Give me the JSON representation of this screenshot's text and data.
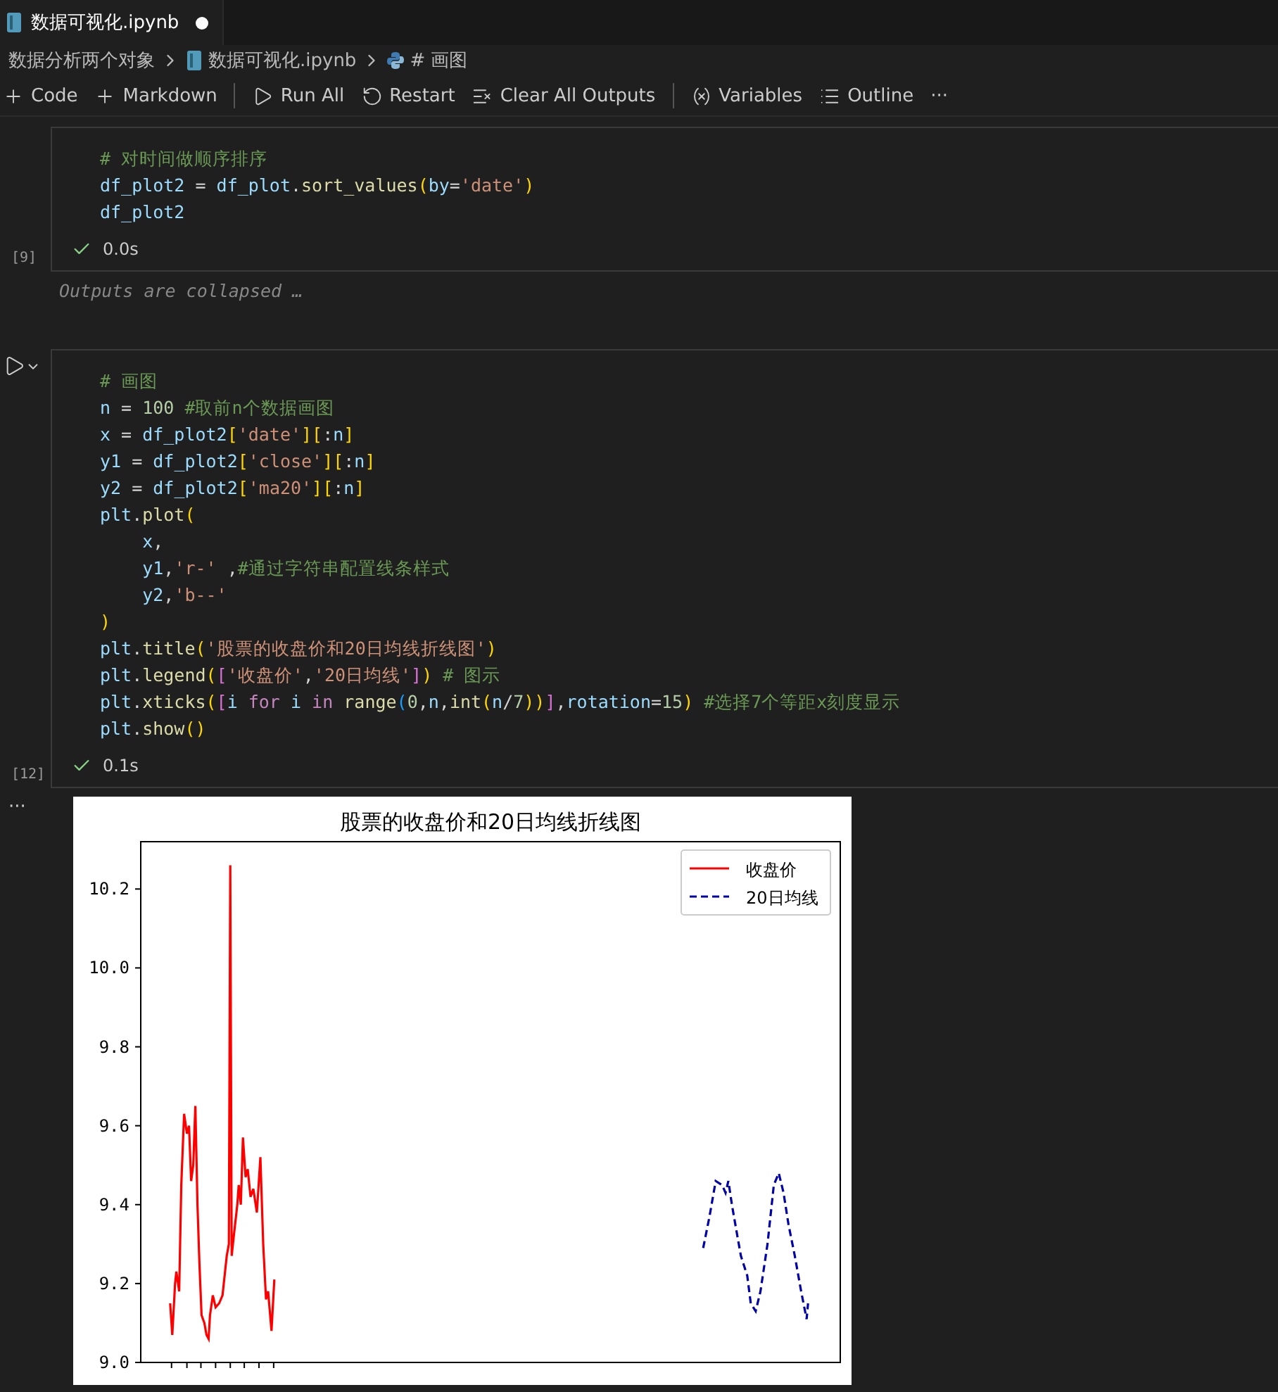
{
  "tab": {
    "title": "数据可视化.ipynb",
    "modified": true
  },
  "breadcrumb": [
    "数据分析两个对象",
    "数据可视化.ipynb",
    "# 画图"
  ],
  "toolbar": [
    {
      "kind": "plus",
      "label": "Code"
    },
    {
      "kind": "plus",
      "label": "Markdown"
    },
    {
      "kind": "separator"
    },
    {
      "kind": "run",
      "label": "Run All"
    },
    {
      "kind": "restart",
      "label": "Restart"
    },
    {
      "kind": "clear",
      "label": "Clear All Outputs"
    },
    {
      "kind": "separator"
    },
    {
      "kind": "variables",
      "label": "Variables"
    },
    {
      "kind": "outline",
      "label": "Outline"
    },
    {
      "kind": "more",
      "label": "···"
    }
  ],
  "cells": [
    {
      "count": "[9]",
      "time": "0.0s",
      "run_button": false,
      "collapsed_note": "Outputs are collapsed …",
      "lines": [
        [
          {
            "text": "# 对时间做顺序排序",
            "kind": "comment"
          }
        ],
        [
          {
            "text": "df_plot2",
            "kind": "var"
          },
          {
            "text": " = ",
            "kind": "plain"
          },
          {
            "text": "df_plot",
            "kind": "var"
          },
          {
            "text": ".",
            "kind": "plain"
          },
          {
            "text": "sort_values",
            "kind": "func"
          },
          {
            "text": "(",
            "kind": "paren"
          },
          {
            "text": "by",
            "kind": "var"
          },
          {
            "text": "=",
            "kind": "plain"
          },
          {
            "text": "'date'",
            "kind": "string"
          },
          {
            "text": ")",
            "kind": "paren"
          }
        ],
        [
          {
            "text": "df_plot2",
            "kind": "var"
          }
        ]
      ]
    },
    {
      "count": "[12]",
      "time": "0.1s",
      "run_button": true,
      "output_marker": "···",
      "lines": [
        [
          {
            "text": "# 画图",
            "kind": "comment"
          }
        ],
        [
          {
            "text": "n",
            "kind": "var"
          },
          {
            "text": " = ",
            "kind": "plain"
          },
          {
            "text": "100",
            "kind": "number"
          },
          {
            "text": " #取前n个数据画图",
            "kind": "comment"
          }
        ],
        [
          {
            "text": "x",
            "kind": "var"
          },
          {
            "text": " = ",
            "kind": "plain"
          },
          {
            "text": "df_plot2",
            "kind": "var"
          },
          {
            "text": "[",
            "kind": "paren"
          },
          {
            "text": "'date'",
            "kind": "string"
          },
          {
            "text": "][",
            "kind": "paren"
          },
          {
            "text": ":",
            "kind": "plain"
          },
          {
            "text": "n",
            "kind": "var"
          },
          {
            "text": "]",
            "kind": "paren"
          }
        ],
        [
          {
            "text": "y1",
            "kind": "var"
          },
          {
            "text": " = ",
            "kind": "plain"
          },
          {
            "text": "df_plot2",
            "kind": "var"
          },
          {
            "text": "[",
            "kind": "paren"
          },
          {
            "text": "'close'",
            "kind": "string"
          },
          {
            "text": "][",
            "kind": "paren"
          },
          {
            "text": ":",
            "kind": "plain"
          },
          {
            "text": "n",
            "kind": "var"
          },
          {
            "text": "]",
            "kind": "paren"
          }
        ],
        [
          {
            "text": "y2",
            "kind": "var"
          },
          {
            "text": " = ",
            "kind": "plain"
          },
          {
            "text": "df_plot2",
            "kind": "var"
          },
          {
            "text": "[",
            "kind": "paren"
          },
          {
            "text": "'ma20'",
            "kind": "string"
          },
          {
            "text": "][",
            "kind": "paren"
          },
          {
            "text": ":",
            "kind": "plain"
          },
          {
            "text": "n",
            "kind": "var"
          },
          {
            "text": "]",
            "kind": "paren"
          }
        ],
        [
          {
            "text": "plt",
            "kind": "var"
          },
          {
            "text": ".",
            "kind": "plain"
          },
          {
            "text": "plot",
            "kind": "func"
          },
          {
            "text": "(",
            "kind": "paren"
          }
        ],
        [
          {
            "text": "    x",
            "kind": "var"
          },
          {
            "text": ",",
            "kind": "plain"
          }
        ],
        [
          {
            "text": "    y1",
            "kind": "var"
          },
          {
            "text": ",",
            "kind": "plain"
          },
          {
            "text": "'r-'",
            "kind": "string"
          },
          {
            "text": " ,",
            "kind": "plain"
          },
          {
            "text": "#通过字符串配置线条样式",
            "kind": "comment"
          }
        ],
        [
          {
            "text": "    y2",
            "kind": "var"
          },
          {
            "text": ",",
            "kind": "plain"
          },
          {
            "text": "'b--'",
            "kind": "string"
          }
        ],
        [
          {
            "text": ")",
            "kind": "paren"
          }
        ],
        [
          {
            "text": "plt",
            "kind": "var"
          },
          {
            "text": ".",
            "kind": "plain"
          },
          {
            "text": "title",
            "kind": "func"
          },
          {
            "text": "(",
            "kind": "paren"
          },
          {
            "text": "'股票的收盘价和20日均线折线图'",
            "kind": "string"
          },
          {
            "text": ")",
            "kind": "paren"
          }
        ],
        [
          {
            "text": "plt",
            "kind": "var"
          },
          {
            "text": ".",
            "kind": "plain"
          },
          {
            "text": "legend",
            "kind": "func"
          },
          {
            "text": "(",
            "kind": "paren"
          },
          {
            "text": "[",
            "kind": "bracket"
          },
          {
            "text": "'收盘价'",
            "kind": "string"
          },
          {
            "text": ",",
            "kind": "plain"
          },
          {
            "text": "'20日均线'",
            "kind": "string"
          },
          {
            "text": "]",
            "kind": "bracket"
          },
          {
            "text": ")",
            "kind": "paren"
          },
          {
            "text": " # 图示",
            "kind": "comment"
          }
        ],
        [
          {
            "text": "plt",
            "kind": "var"
          },
          {
            "text": ".",
            "kind": "plain"
          },
          {
            "text": "xticks",
            "kind": "func"
          },
          {
            "text": "(",
            "kind": "paren"
          },
          {
            "text": "[",
            "kind": "bracket"
          },
          {
            "text": "i",
            "kind": "var"
          },
          {
            "text": " for ",
            "kind": "keyword"
          },
          {
            "text": "i",
            "kind": "var"
          },
          {
            "text": " in ",
            "kind": "keyword"
          },
          {
            "text": "range",
            "kind": "func"
          },
          {
            "text": "(",
            "kind": "paren3"
          },
          {
            "text": "0",
            "kind": "number"
          },
          {
            "text": ",",
            "kind": "plain"
          },
          {
            "text": "n",
            "kind": "var"
          },
          {
            "text": ",",
            "kind": "plain"
          },
          {
            "text": "int",
            "kind": "func"
          },
          {
            "text": "(",
            "kind": "paren"
          },
          {
            "text": "n",
            "kind": "var"
          },
          {
            "text": "/",
            "kind": "plain"
          },
          {
            "text": "7",
            "kind": "number"
          },
          {
            "text": "))",
            "kind": "paren"
          },
          {
            "text": "]",
            "kind": "bracket"
          },
          {
            "text": ",",
            "kind": "plain"
          },
          {
            "text": "rotation",
            "kind": "var"
          },
          {
            "text": "=",
            "kind": "plain"
          },
          {
            "text": "15",
            "kind": "number"
          },
          {
            "text": ")",
            "kind": "paren"
          },
          {
            "text": " #选择7个等距x刻度显示",
            "kind": "comment"
          }
        ],
        [
          {
            "text": "plt",
            "kind": "var"
          },
          {
            "text": ".",
            "kind": "plain"
          },
          {
            "text": "show",
            "kind": "func"
          },
          {
            "text": "()",
            "kind": "paren"
          }
        ]
      ],
      "figure": {
        "title": "股票的收盘价和20日均线折线图",
        "y_axis_labels": [
          "10.2",
          "10.0",
          "9.8",
          "9.6",
          "9.4",
          "9.2",
          "9.0"
        ],
        "legend": [
          {
            "label": "收盘价",
            "color": "#ff0000"
          },
          {
            "label": "20日均线",
            "color": "#0000aa"
          }
        ]
      }
    }
  ]
}
